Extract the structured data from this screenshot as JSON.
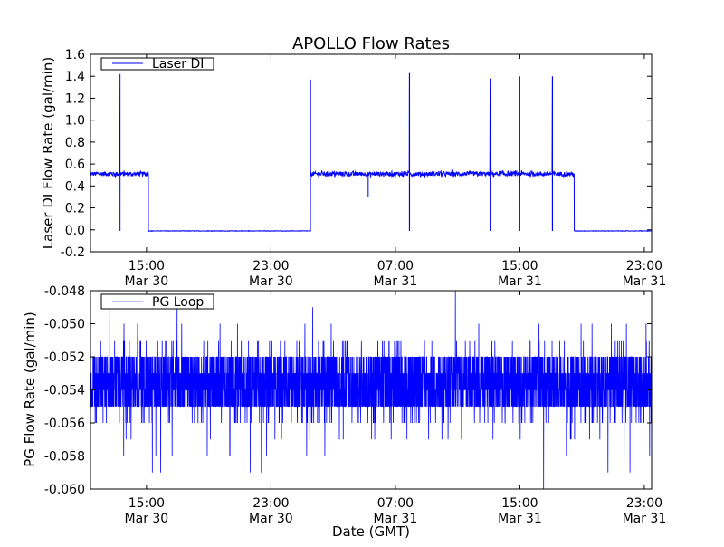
{
  "chart_data": [
    {
      "type": "line",
      "title": "APOLLO Flow Rates",
      "xlabel": "",
      "ylabel": "Laser DI Flow Rate (gal/min)",
      "x_units": "hours since Mar 30 00:00 GMT",
      "xlim": [
        11.4,
        47.47
      ],
      "ylim": [
        -0.2,
        1.6
      ],
      "yticks": [
        -0.2,
        0.0,
        0.2,
        0.4,
        0.6,
        0.8,
        1.0,
        1.2,
        1.4,
        1.6
      ],
      "ytick_labels": [
        "-0.2",
        "0.0",
        "0.2",
        "0.4",
        "0.6",
        "0.8",
        "1.0",
        "1.2",
        "1.4",
        "1.6"
      ],
      "xticks": [
        15,
        23,
        31,
        39,
        47
      ],
      "xtick_labels": [
        [
          "15:00",
          "Mar 30"
        ],
        [
          "23:00",
          "Mar 30"
        ],
        [
          "07:00",
          "Mar 31"
        ],
        [
          "15:00",
          "Mar 31"
        ],
        [
          "23:00",
          "Mar 31"
        ]
      ],
      "legend": {
        "label": "Laser DI",
        "placement": "top-left"
      },
      "color": "#0000ff",
      "series": [
        {
          "name": "Laser DI",
          "segments": [
            {
              "from": 11.4,
              "to": 15.12,
              "level": 0.51,
              "noise": 0.02
            },
            {
              "from": 15.12,
              "to": 25.55,
              "level": -0.01,
              "noise": 0.002
            },
            {
              "from": 25.55,
              "to": 42.5,
              "level": 0.51,
              "noise": 0.02
            },
            {
              "from": 42.5,
              "to": 47.47,
              "level": -0.01,
              "noise": 0.002
            }
          ],
          "spikes": [
            {
              "x": 13.3,
              "high": 1.42,
              "low": -0.01
            },
            {
              "x": 25.55,
              "high": 1.37,
              "low": 0.51
            },
            {
              "x": 29.25,
              "high": 0.51,
              "low": 0.3
            },
            {
              "x": 31.9,
              "high": 1.43,
              "low": -0.01
            },
            {
              "x": 37.1,
              "high": 1.38,
              "low": -0.01
            },
            {
              "x": 39.0,
              "high": 1.4,
              "low": -0.01
            },
            {
              "x": 41.1,
              "high": 1.4,
              "low": -0.01
            }
          ]
        }
      ]
    },
    {
      "type": "line",
      "title": "",
      "xlabel": "Date (GMT)",
      "ylabel": "PG Flow Rate (gal/min)",
      "x_units": "hours since Mar 30 00:00 GMT",
      "xlim": [
        11.4,
        47.47
      ],
      "ylim": [
        -0.06,
        -0.048
      ],
      "yticks": [
        -0.06,
        -0.058,
        -0.056,
        -0.054,
        -0.052,
        -0.05,
        -0.048
      ],
      "ytick_labels": [
        "-0.060",
        "-0.058",
        "-0.056",
        "-0.054",
        "-0.052",
        "-0.050",
        "-0.048"
      ],
      "xticks": [
        15,
        23,
        31,
        39,
        47
      ],
      "xtick_labels": [
        [
          "15:00",
          "Mar 30"
        ],
        [
          "23:00",
          "Mar 30"
        ],
        [
          "07:00",
          "Mar 31"
        ],
        [
          "15:00",
          "Mar 31"
        ],
        [
          "23:00",
          "Mar 31"
        ]
      ],
      "legend": {
        "label": "PG Loop",
        "placement": "top-left"
      },
      "color": "#0000ff",
      "series": [
        {
          "name": "PG Loop",
          "resolution": 0.001,
          "core_range": [
            -0.055,
            -0.052
          ],
          "value_distribution": [
            {
              "value": -0.048,
              "p": 0.0003
            },
            {
              "value": -0.049,
              "p": 0.001
            },
            {
              "value": -0.05,
              "p": 0.003
            },
            {
              "value": -0.051,
              "p": 0.015
            },
            {
              "value": -0.052,
              "p": 0.2
            },
            {
              "value": -0.053,
              "p": 0.22
            },
            {
              "value": -0.054,
              "p": 0.25
            },
            {
              "value": -0.055,
              "p": 0.27
            },
            {
              "value": -0.056,
              "p": 0.03
            },
            {
              "value": -0.057,
              "p": 0.007
            },
            {
              "value": -0.058,
              "p": 0.003
            },
            {
              "value": -0.059,
              "p": 0.001
            },
            {
              "value": -0.06,
              "p": 0.0003
            }
          ]
        }
      ]
    }
  ]
}
